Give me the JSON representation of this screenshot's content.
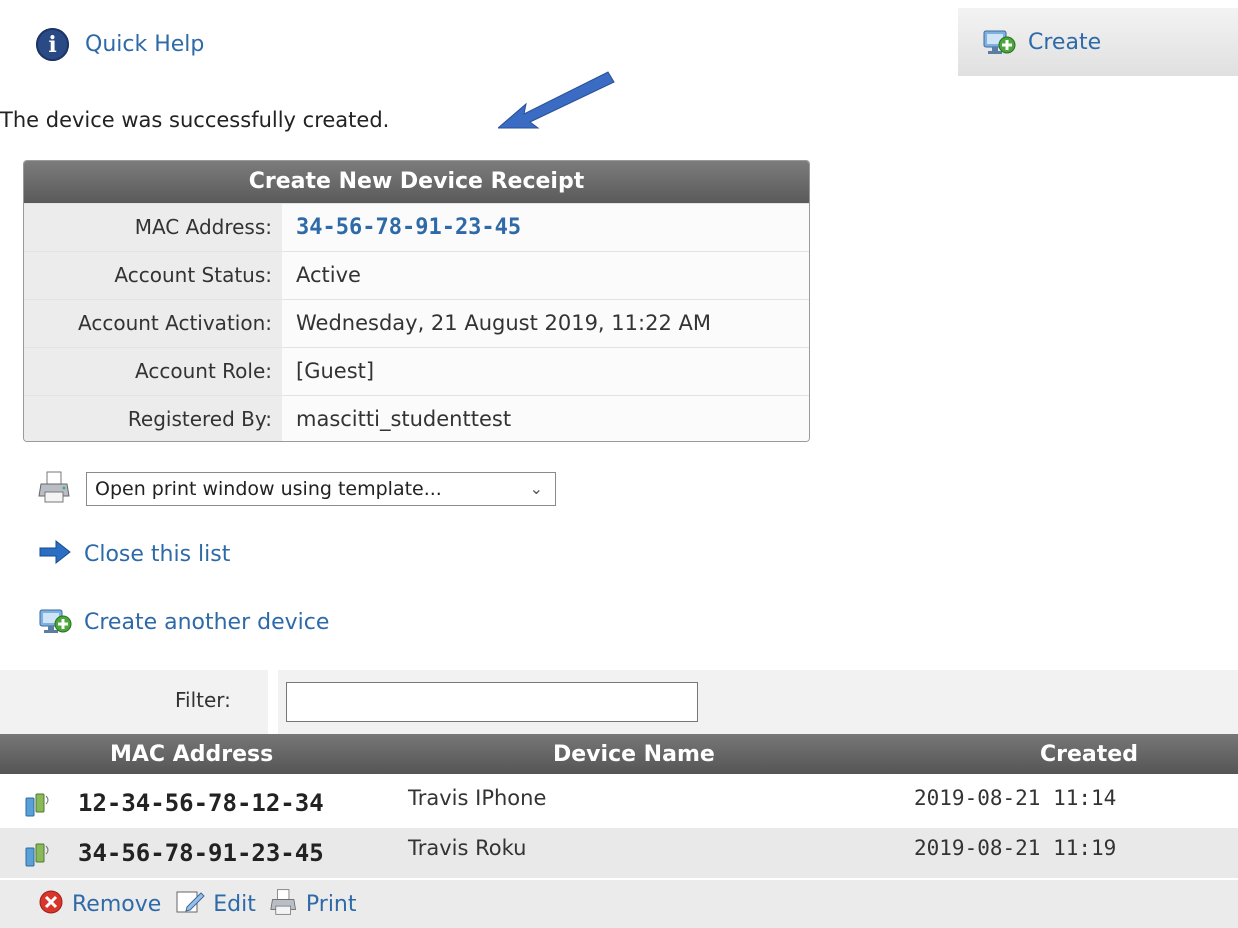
{
  "header": {
    "quick_help": "Quick Help",
    "create_tab": "Create"
  },
  "message": "The device was successfully created.",
  "receipt": {
    "title": "Create New Device Receipt",
    "rows": [
      {
        "label": "MAC Address:",
        "value": "34-56-78-91-23-45"
      },
      {
        "label": "Account Status:",
        "value": "Active"
      },
      {
        "label": "Account Activation:",
        "value": "Wednesday, 21 August 2019, 11:22 AM"
      },
      {
        "label": "Account Role:",
        "value": "[Guest]"
      },
      {
        "label": "Registered By:",
        "value": "mascitti_studenttest"
      }
    ]
  },
  "print": {
    "select_value": "Open print window using template..."
  },
  "actions": {
    "close_list": "Close this list",
    "create_another": "Create another device"
  },
  "filter": {
    "label": "Filter:",
    "value": ""
  },
  "table": {
    "columns": [
      "MAC Address",
      "Device Name",
      "Created"
    ],
    "rows": [
      {
        "mac": "12-34-56-78-12-34",
        "name": "Travis IPhone",
        "created": "2019-08-21 11:14"
      },
      {
        "mac": "34-56-78-91-23-45",
        "name": "Travis Roku",
        "created": "2019-08-21 11:19"
      }
    ]
  },
  "footer": {
    "remove": "Remove",
    "edit": "Edit",
    "print": "Print"
  },
  "colors": {
    "link": "#2e6aa8",
    "header_bar": "#666666",
    "annotation_arrow": "#3b6cc4"
  },
  "icons": {
    "quick_help": "info-icon",
    "create": "create-device-icon",
    "print": "printer-icon",
    "close": "arrow-right-icon",
    "device": "device-icon",
    "remove": "remove-icon",
    "edit": "edit-icon"
  }
}
